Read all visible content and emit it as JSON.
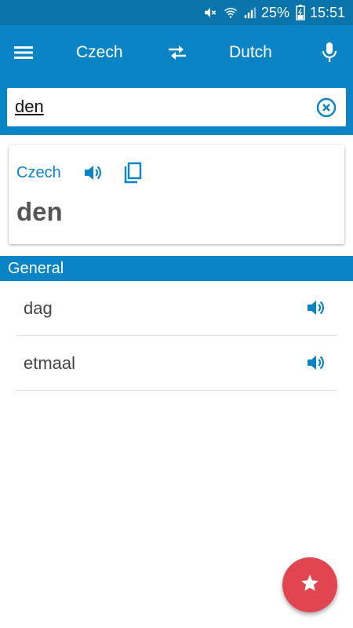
{
  "status_bar": {
    "battery_percent": "25%",
    "time": "15:51"
  },
  "app_bar": {
    "source_language": "Czech",
    "target_language": "Dutch",
    "icons": [
      "menu-icon",
      "swap-icon",
      "microphone-icon"
    ]
  },
  "search": {
    "value": "den",
    "clear_icon": "clear-circle-icon"
  },
  "card": {
    "language": "Czech",
    "word": "den",
    "icons": [
      "speaker-icon",
      "copy-icon"
    ]
  },
  "results": {
    "section_title": "General",
    "items": [
      {
        "text": "dag"
      },
      {
        "text": "etmaal"
      }
    ]
  },
  "fab": {
    "icon": "star-icon"
  },
  "colors": {
    "status_bar": "#0a75ad",
    "primary": "#0b84c6",
    "fab": "#e04550",
    "word": "#555555"
  }
}
